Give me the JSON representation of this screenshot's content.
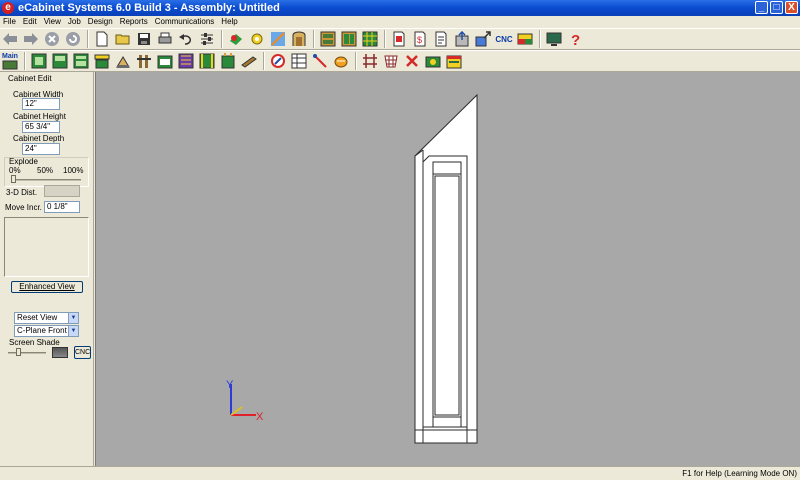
{
  "window": {
    "title": "eCabinet Systems 6.0 Build 3 - Assembly: Untitled",
    "app_icon_letter": "e",
    "minimize_label": "_",
    "maximize_label": "□",
    "close_label": "X"
  },
  "menu": [
    "File",
    "Edit",
    "View",
    "Job",
    "Design",
    "Reports",
    "Communications",
    "Help"
  ],
  "toolbar1": {
    "icons": [
      "back-arrow-icon",
      "forward-arrow-icon",
      "stop-icon",
      "refresh-icon",
      "new-document-icon",
      "open-folder-icon",
      "save-disk-icon",
      "print-icon",
      "undo-icon",
      "settings-sliders-icon",
      "materials-icon",
      "hardware-icon",
      "render-icon",
      "door-style-icon",
      "cut-list-icon",
      "sheet-layout-icon",
      "optimizer-icon",
      "report-icon",
      "pricing-icon",
      "document-icon",
      "export-icon",
      "upload-icon",
      "toggle-icon",
      "display-icon",
      "help-icon"
    ],
    "cnc_label": "CNC"
  },
  "toolbar2": {
    "main_label": "Main",
    "icons": [
      "cabinet-icon",
      "upper-cabinet-icon",
      "cabinet-drawers-icon",
      "countertop-icon",
      "frame-icon",
      "base-cabinet-icon",
      "grid-cabinet-icon",
      "corner-cabinet-icon",
      "shelf-icon",
      "door-icon",
      "tools-icon",
      "pencil-icon",
      "edge-banding-icon",
      "dimension-icon",
      "grid-icon",
      "delete-icon",
      "camera-icon",
      "calendar-icon"
    ]
  },
  "left_panel": {
    "title": "Cabinet Edit",
    "width_label": "Cabinet Width",
    "width_value": "12\"",
    "height_label": "Cabinet Height",
    "height_value": "65 3/4\"",
    "depth_label": "Cabinet Depth",
    "depth_value": "24\"",
    "explode_label": "Explode",
    "explode_ticks": [
      "0%",
      "50%",
      "100%"
    ],
    "explode_level": 0,
    "dist_label": "3-D Dist.",
    "move_label": "Move Incr.",
    "move_value": "0 1/8\"",
    "enhanced_view_label": "Enhanced View",
    "reset_view_label": "Reset View",
    "plane_label": "C-Plane Front",
    "screen_shade_label": "Screen Shade",
    "screen_shade_level": 0.25,
    "cnc_button_label": "CNC"
  },
  "axis": {
    "y_label": "Y",
    "x_label": "X",
    "y_color": "#2e3bd8",
    "x_color": "#e0202a",
    "origin_color": "#e0c020"
  },
  "status": {
    "text": "F1 for Help (Learning Mode ON)"
  },
  "colors": {
    "titlebar": "#0a4bcf",
    "canvas": "#a8a8a8",
    "panel": "#ece9d8"
  }
}
